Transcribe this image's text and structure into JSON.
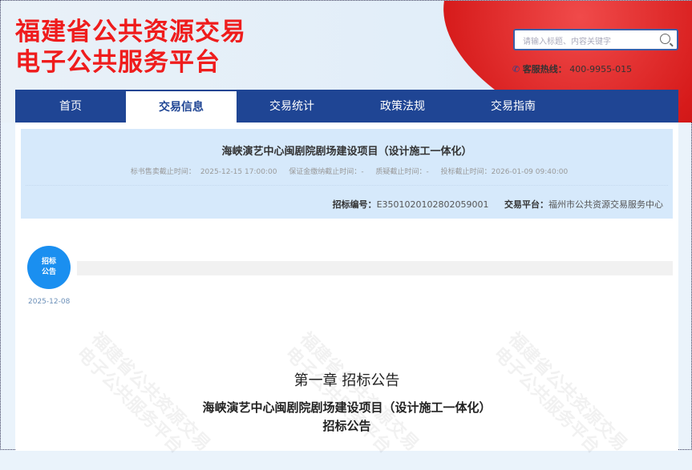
{
  "header": {
    "logo_line1": "福建省公共资源交易",
    "logo_line2": "电子公共服务平台",
    "search_placeholder": "请输入标题、内容关键字",
    "hotline_label": "客服热线：",
    "hotline_number": "400-9955-015"
  },
  "nav": {
    "items": [
      {
        "label": "首页"
      },
      {
        "label": "交易信息"
      },
      {
        "label": "交易统计"
      },
      {
        "label": "政策法规"
      },
      {
        "label": "交易指南"
      }
    ],
    "active": "交易信息"
  },
  "project": {
    "title": "海峡演艺中心闽剧院剧场建设项目（设计施工一体化）",
    "times": [
      {
        "label": "标书售卖截止时间：",
        "value": "2025-12-15 17:00:00"
      },
      {
        "label": "保证金缴纳截止时间：",
        "value": "-"
      },
      {
        "label": "质疑截止时间：",
        "value": "-"
      },
      {
        "label": "投标截止时间：",
        "value": "2026-01-09 09:40:00"
      }
    ],
    "code_label": "招标编号：",
    "code": "E3501020102802059001",
    "platform_label": "交易平台：",
    "platform": "福州市公共资源交易服务中心"
  },
  "timeline": {
    "node_line1": "招标",
    "node_line2": "公告",
    "date": "2025-12-08"
  },
  "document": {
    "chapter": "第一章  招标公告",
    "subtitle": "海峡演艺中心闽剧院剧场建设项目（设计施工一体化）",
    "subtitle2": "招标公告"
  },
  "watermark": "福建省公共资源交易 电子公共服务平台"
}
